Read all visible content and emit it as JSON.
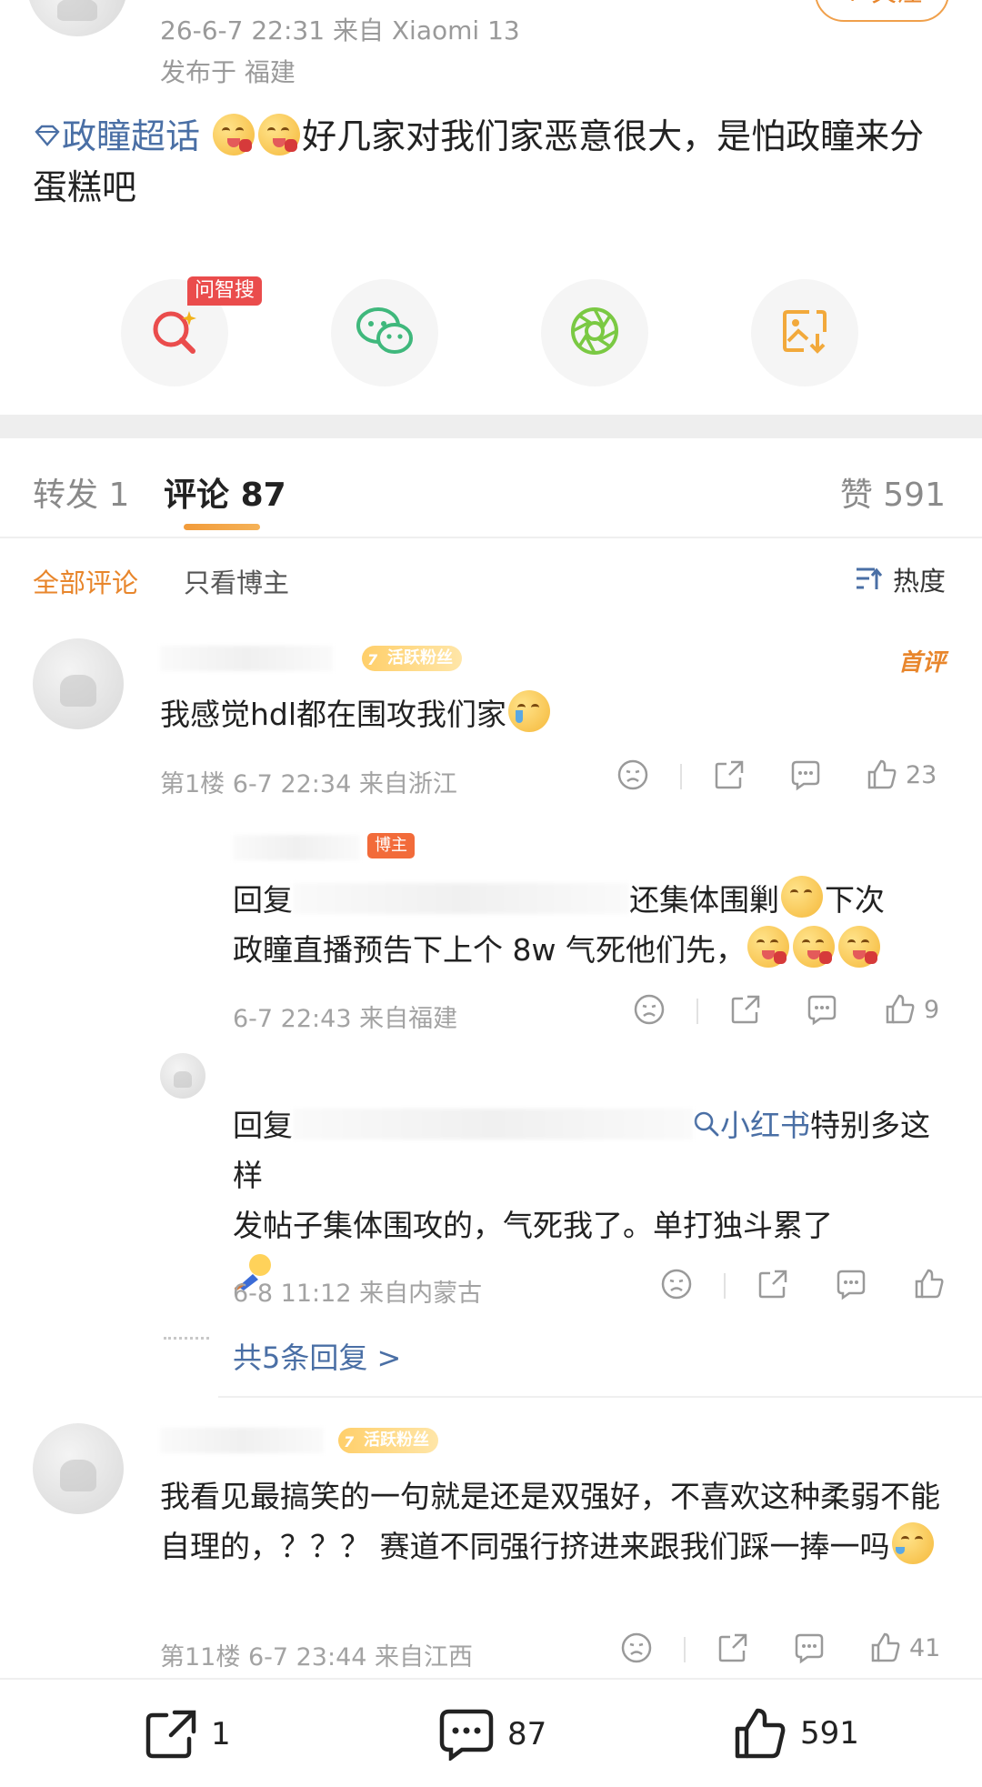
{
  "post": {
    "date_source": "26-6-7 22:31  来自",
    "device": "Xiaomi 13",
    "location": "发布于 福建",
    "follow_label": "+ 关注",
    "topic": "政瞳超话",
    "content": "好几家对我们家恶意很大，是怕政瞳来分蛋糕吧"
  },
  "share_actions": {
    "ai_badge": "问智搜",
    "items": [
      {
        "name": "ai-search",
        "icon": "ai-search-icon"
      },
      {
        "name": "wechat",
        "icon": "wechat-icon"
      },
      {
        "name": "moments",
        "icon": "moments-icon"
      },
      {
        "name": "save-image",
        "icon": "save-image-icon"
      }
    ]
  },
  "tabs": {
    "repost": "转发",
    "repost_count": "1",
    "comment": "评论",
    "comment_count": "87",
    "like": "赞",
    "like_count": "591"
  },
  "filters": {
    "all": "全部评论",
    "author_only": "只看博主",
    "sort": "热度"
  },
  "comments": [
    {
      "badge": "活跃粉丝",
      "first_tag": "首评",
      "text": "我感觉hdl都在围攻我们家",
      "meta": "第1楼 6-7 22:34 来自浙江",
      "likes": "23"
    },
    {
      "badge": "活跃粉丝",
      "text": "我看见最搞笑的一句就是还是双强好，不喜欢这种柔弱不能自理的，？？？ 赛道不同强行挤进来跟我们踩一捧一吗",
      "meta": "第11楼 6-7 23:44 来自江西",
      "likes": "41"
    }
  ],
  "replies": [
    {
      "badge": "博主",
      "prefix": "回复",
      "text_line1_tail": "还集体围剿",
      "text_line1_end": "下次",
      "text_line2": "政瞳直播预告下上个 8w 气死他们先，",
      "meta": "6-7 22:43 来自福建",
      "likes": "9"
    },
    {
      "prefix": "回复",
      "link": "小红书",
      "text_line1_tail": "特别多这样",
      "text_line2": "发帖子集体围攻的，气死我了。单打独斗累了",
      "meta": "6-8 11:12 来自内蒙古"
    }
  ],
  "more_replies": "共5条回复 >",
  "bottom_bar": {
    "repost_count": "1",
    "comment_count": "87",
    "like_count": "591"
  },
  "colors": {
    "accent_orange": "#e8862c",
    "link_blue": "#4a6fa5"
  }
}
